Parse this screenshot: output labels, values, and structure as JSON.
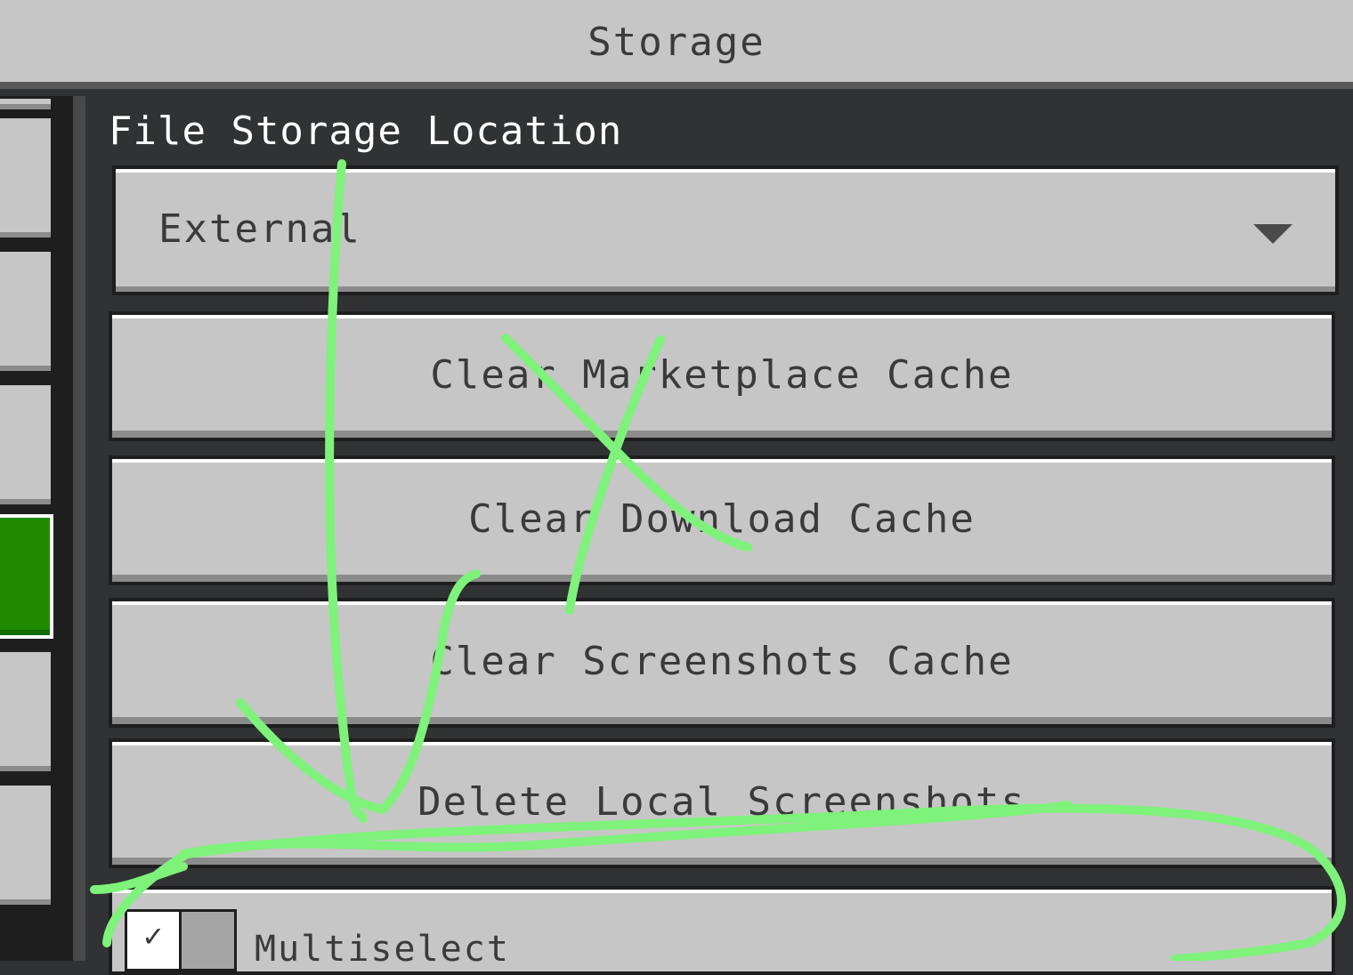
{
  "header": {
    "title": "Storage"
  },
  "storage": {
    "section_label": "File Storage Location",
    "dropdown_value": "External"
  },
  "buttons": {
    "clear_marketplace": "Clear Marketplace Cache",
    "clear_download": "Clear Download Cache",
    "clear_screenshots": "Clear Screenshots Cache",
    "delete_local_screenshots": "Delete Local Screenshots"
  },
  "toggle": {
    "label": "Multiselect",
    "checkmark": "✓",
    "state": "on"
  },
  "colors": {
    "annotation": "#7ef27a",
    "active_tab": "#1e8a00",
    "panel": "#c6c6c6"
  }
}
